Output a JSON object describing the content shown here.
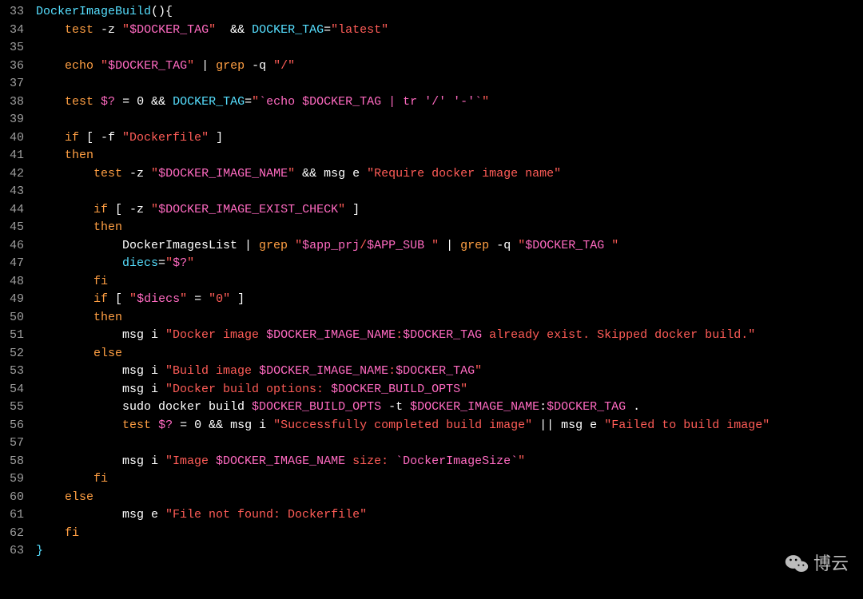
{
  "watermark": {
    "text": "博云"
  },
  "lines": [
    {
      "n": "33",
      "segs": [
        {
          "t": " ",
          "c": "white"
        },
        {
          "t": "DockerImageBuild",
          "c": "cyan"
        },
        {
          "t": "(){",
          "c": "white"
        }
      ]
    },
    {
      "n": "34",
      "segs": [
        {
          "t": "     ",
          "c": "white"
        },
        {
          "t": "test",
          "c": "orange"
        },
        {
          "t": " -z ",
          "c": "white"
        },
        {
          "t": "\"",
          "c": "red"
        },
        {
          "t": "$DOCKER_TAG",
          "c": "magenta"
        },
        {
          "t": "\"",
          "c": "red"
        },
        {
          "t": "  && ",
          "c": "white"
        },
        {
          "t": "DOCKER_TAG",
          "c": "cyan"
        },
        {
          "t": "=",
          "c": "white"
        },
        {
          "t": "\"latest\"",
          "c": "red"
        }
      ]
    },
    {
      "n": "35",
      "segs": []
    },
    {
      "n": "36",
      "segs": [
        {
          "t": "     ",
          "c": "white"
        },
        {
          "t": "echo",
          "c": "orange"
        },
        {
          "t": " ",
          "c": "white"
        },
        {
          "t": "\"",
          "c": "red"
        },
        {
          "t": "$DOCKER_TAG",
          "c": "magenta"
        },
        {
          "t": "\"",
          "c": "red"
        },
        {
          "t": " | ",
          "c": "white"
        },
        {
          "t": "grep",
          "c": "orange"
        },
        {
          "t": " -q ",
          "c": "white"
        },
        {
          "t": "\"/\"",
          "c": "red"
        }
      ]
    },
    {
      "n": "37",
      "segs": []
    },
    {
      "n": "38",
      "segs": [
        {
          "t": "     ",
          "c": "white"
        },
        {
          "t": "test",
          "c": "orange"
        },
        {
          "t": " ",
          "c": "white"
        },
        {
          "t": "$?",
          "c": "magenta"
        },
        {
          "t": " = 0 && ",
          "c": "white"
        },
        {
          "t": "DOCKER_TAG",
          "c": "cyan"
        },
        {
          "t": "=",
          "c": "white"
        },
        {
          "t": "\"",
          "c": "red"
        },
        {
          "t": "`echo $DOCKER_TAG | tr '/' '-'`",
          "c": "magenta"
        },
        {
          "t": "\"",
          "c": "red"
        }
      ]
    },
    {
      "n": "39",
      "segs": []
    },
    {
      "n": "40",
      "segs": [
        {
          "t": "     ",
          "c": "white"
        },
        {
          "t": "if",
          "c": "orange"
        },
        {
          "t": " [ -f ",
          "c": "white"
        },
        {
          "t": "\"Dockerfile\"",
          "c": "red"
        },
        {
          "t": " ]",
          "c": "white"
        }
      ]
    },
    {
      "n": "41",
      "segs": [
        {
          "t": "     ",
          "c": "white"
        },
        {
          "t": "then",
          "c": "orange"
        }
      ]
    },
    {
      "n": "42",
      "segs": [
        {
          "t": "         ",
          "c": "white"
        },
        {
          "t": "test",
          "c": "orange"
        },
        {
          "t": " -z ",
          "c": "white"
        },
        {
          "t": "\"",
          "c": "red"
        },
        {
          "t": "$DOCKER_IMAGE_NAME",
          "c": "magenta"
        },
        {
          "t": "\"",
          "c": "red"
        },
        {
          "t": " && msg e ",
          "c": "white"
        },
        {
          "t": "\"Require docker image name\"",
          "c": "red"
        }
      ]
    },
    {
      "n": "43",
      "segs": []
    },
    {
      "n": "44",
      "segs": [
        {
          "t": "         ",
          "c": "white"
        },
        {
          "t": "if",
          "c": "orange"
        },
        {
          "t": " [ -z ",
          "c": "white"
        },
        {
          "t": "\"",
          "c": "red"
        },
        {
          "t": "$DOCKER_IMAGE_EXIST_CHECK",
          "c": "magenta"
        },
        {
          "t": "\"",
          "c": "red"
        },
        {
          "t": " ]",
          "c": "white"
        }
      ]
    },
    {
      "n": "45",
      "segs": [
        {
          "t": "         ",
          "c": "white"
        },
        {
          "t": "then",
          "c": "orange"
        }
      ]
    },
    {
      "n": "46",
      "segs": [
        {
          "t": "             DockerImagesList | ",
          "c": "white"
        },
        {
          "t": "grep",
          "c": "orange"
        },
        {
          "t": " ",
          "c": "white"
        },
        {
          "t": "\"",
          "c": "red"
        },
        {
          "t": "$app_prj",
          "c": "magenta"
        },
        {
          "t": "/",
          "c": "red"
        },
        {
          "t": "$APP_SUB",
          "c": "magenta"
        },
        {
          "t": " \"",
          "c": "red"
        },
        {
          "t": " | ",
          "c": "white"
        },
        {
          "t": "grep",
          "c": "orange"
        },
        {
          "t": " -q ",
          "c": "white"
        },
        {
          "t": "\"",
          "c": "red"
        },
        {
          "t": "$DOCKER_TAG",
          "c": "magenta"
        },
        {
          "t": " \"",
          "c": "red"
        }
      ]
    },
    {
      "n": "47",
      "segs": [
        {
          "t": "             ",
          "c": "white"
        },
        {
          "t": "diecs",
          "c": "cyan"
        },
        {
          "t": "=",
          "c": "white"
        },
        {
          "t": "\"",
          "c": "red"
        },
        {
          "t": "$?",
          "c": "magenta"
        },
        {
          "t": "\"",
          "c": "red"
        }
      ]
    },
    {
      "n": "48",
      "segs": [
        {
          "t": "         ",
          "c": "white"
        },
        {
          "t": "fi",
          "c": "orange"
        }
      ]
    },
    {
      "n": "49",
      "segs": [
        {
          "t": "         ",
          "c": "white"
        },
        {
          "t": "if",
          "c": "orange"
        },
        {
          "t": " [ ",
          "c": "white"
        },
        {
          "t": "\"",
          "c": "red"
        },
        {
          "t": "$diecs",
          "c": "magenta"
        },
        {
          "t": "\"",
          "c": "red"
        },
        {
          "t": " = ",
          "c": "white"
        },
        {
          "t": "\"0\"",
          "c": "red"
        },
        {
          "t": " ]",
          "c": "white"
        }
      ]
    },
    {
      "n": "50",
      "segs": [
        {
          "t": "         ",
          "c": "white"
        },
        {
          "t": "then",
          "c": "orange"
        }
      ]
    },
    {
      "n": "51",
      "segs": [
        {
          "t": "             msg i ",
          "c": "white"
        },
        {
          "t": "\"Docker image ",
          "c": "red"
        },
        {
          "t": "$DOCKER_IMAGE_NAME",
          "c": "magenta"
        },
        {
          "t": ":",
          "c": "red"
        },
        {
          "t": "$DOCKER_TAG",
          "c": "magenta"
        },
        {
          "t": " already exist. Skipped docker build.\"",
          "c": "red"
        }
      ]
    },
    {
      "n": "52",
      "segs": [
        {
          "t": "         ",
          "c": "white"
        },
        {
          "t": "else",
          "c": "orange"
        }
      ]
    },
    {
      "n": "53",
      "segs": [
        {
          "t": "             msg i ",
          "c": "white"
        },
        {
          "t": "\"Build image ",
          "c": "red"
        },
        {
          "t": "$DOCKER_IMAGE_NAME",
          "c": "magenta"
        },
        {
          "t": ":",
          "c": "red"
        },
        {
          "t": "$DOCKER_TAG",
          "c": "magenta"
        },
        {
          "t": "\"",
          "c": "red"
        }
      ]
    },
    {
      "n": "54",
      "segs": [
        {
          "t": "             msg i ",
          "c": "white"
        },
        {
          "t": "\"Docker build options: ",
          "c": "red"
        },
        {
          "t": "$DOCKER_BUILD_OPTS",
          "c": "magenta"
        },
        {
          "t": "\"",
          "c": "red"
        }
      ]
    },
    {
      "n": "55",
      "segs": [
        {
          "t": "             sudo docker build ",
          "c": "white"
        },
        {
          "t": "$DOCKER_BUILD_OPTS",
          "c": "magenta"
        },
        {
          "t": " -t ",
          "c": "white"
        },
        {
          "t": "$DOCKER_IMAGE_NAME",
          "c": "magenta"
        },
        {
          "t": ":",
          "c": "white"
        },
        {
          "t": "$DOCKER_TAG",
          "c": "magenta"
        },
        {
          "t": " .",
          "c": "white"
        }
      ]
    },
    {
      "n": "56",
      "segs": [
        {
          "t": "             ",
          "c": "white"
        },
        {
          "t": "test",
          "c": "orange"
        },
        {
          "t": " ",
          "c": "white"
        },
        {
          "t": "$?",
          "c": "magenta"
        },
        {
          "t": " = 0 && msg i ",
          "c": "white"
        },
        {
          "t": "\"Successfully completed build image\"",
          "c": "red"
        },
        {
          "t": " || msg e ",
          "c": "white"
        },
        {
          "t": "\"Failed to build image\"",
          "c": "red"
        }
      ]
    },
    {
      "n": "57",
      "segs": []
    },
    {
      "n": "58",
      "segs": [
        {
          "t": "             msg i ",
          "c": "white"
        },
        {
          "t": "\"Image ",
          "c": "red"
        },
        {
          "t": "$DOCKER_IMAGE_NAME",
          "c": "magenta"
        },
        {
          "t": " size: ",
          "c": "red"
        },
        {
          "t": "`DockerImageSize`",
          "c": "magenta"
        },
        {
          "t": "\"",
          "c": "red"
        }
      ]
    },
    {
      "n": "59",
      "segs": [
        {
          "t": "         ",
          "c": "white"
        },
        {
          "t": "fi",
          "c": "orange"
        }
      ]
    },
    {
      "n": "60",
      "segs": [
        {
          "t": "     ",
          "c": "white"
        },
        {
          "t": "else",
          "c": "orange"
        }
      ]
    },
    {
      "n": "61",
      "segs": [
        {
          "t": "             msg e ",
          "c": "white"
        },
        {
          "t": "\"File not found: Dockerfile\"",
          "c": "red"
        }
      ]
    },
    {
      "n": "62",
      "segs": [
        {
          "t": "     ",
          "c": "white"
        },
        {
          "t": "fi",
          "c": "orange"
        }
      ]
    },
    {
      "n": "63",
      "segs": [
        {
          "t": " ",
          "c": "white"
        },
        {
          "t": "}",
          "c": "cyan"
        }
      ]
    }
  ]
}
